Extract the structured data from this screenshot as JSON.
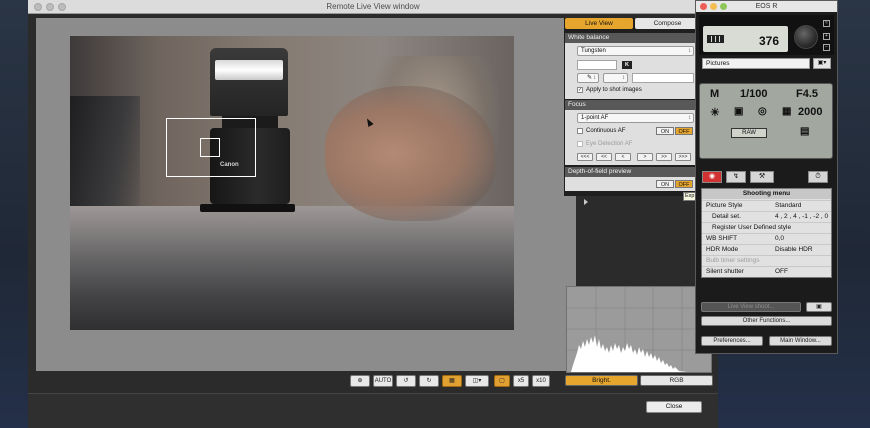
{
  "remote_live_view": {
    "title": "Remote Live View window",
    "tabs": {
      "live_view": "Live View",
      "compose": "Compose"
    },
    "white_balance": {
      "heading": "White balance",
      "mode": "Tungsten",
      "kelvin_badge": "K",
      "apply_to_shot_images": "Apply to shot images",
      "apply_checked": true
    },
    "focus": {
      "heading": "Focus",
      "af_mode": "1-point AF",
      "continuous_af": "Continuous AF",
      "continuous_on": "ON",
      "continuous_off": "OFF",
      "eye_detection_af": "Eye Detection AF",
      "nav_buttons": [
        "<<<",
        "<<",
        "<",
        ">",
        ">>",
        ">>>"
      ]
    },
    "depth_of_field": {
      "heading": "Depth-of-field preview",
      "on": "ON",
      "off": "OFF",
      "tooltip_fragment": "Exp"
    },
    "photo_text": {
      "brand_on_flash": "Canon"
    },
    "toolbar": [
      "crosshair-icon",
      "auto-rotate-icon",
      "rotate-left-icon",
      "rotate-right-icon",
      "grid-icon",
      "aspect-icon",
      "zoom-fit-icon",
      "zoom-x5-icon",
      "zoom-x10-icon"
    ],
    "toolbar_labels": {
      "auto": "AUTO",
      "x5": "x5",
      "x10": "x10"
    },
    "histogram": {
      "bright_label": "Bright.",
      "rgb_label": "RGB"
    },
    "close_label": "Close"
  },
  "eos_window": {
    "title": "EOS R",
    "shots_remaining": "376",
    "save_destination": "Pictures",
    "lcd": {
      "mode": "M",
      "shutter": "1/100",
      "aperture": "F4.5",
      "iso": "2000",
      "quality": "RAW"
    },
    "shooting_menu": {
      "heading": "Shooting menu",
      "rows": [
        {
          "key": "Picture Style",
          "value": "Standard"
        },
        {
          "key": "Detail set.",
          "value": "4 , 2 , 4 , -1 , -2 , 0"
        },
        {
          "key": "Register User Defined style",
          "value": ""
        },
        {
          "key": "WB SHIFT",
          "value": "0,0"
        },
        {
          "key": "HDR Mode",
          "value": "Disable HDR"
        },
        {
          "key": "Bulb timer settings",
          "value": ""
        },
        {
          "key": "Silent shutter",
          "value": "OFF"
        }
      ]
    },
    "buttons": {
      "live_view_shoot": "Live View shoot...",
      "other_functions": "Other Functions...",
      "preferences": "Preferences...",
      "main_window": "Main Window..."
    }
  },
  "colors": {
    "accent_orange": "#e6a52d",
    "panel_dark": "#2b2b2b",
    "lcd_green": "#a2a7a0"
  }
}
